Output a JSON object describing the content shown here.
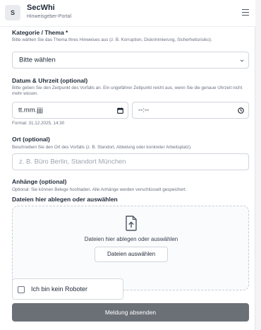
{
  "header": {
    "logo_letter": "S",
    "title": "SecWhi",
    "subtitle": "Hinweisgeber-Portal",
    "menu_icon": "hamburger-menu-icon"
  },
  "category": {
    "label": "Kategorie / Thema *",
    "hint": "Bitte wählen Sie das Thema Ihres Hinweises aus (z. B. Korruption, Diskriminierung, Sicherheitsrisiko).",
    "selected": "Bitte wählen"
  },
  "datetime": {
    "label": "Datum & Uhrzeit (optional)",
    "hint": "Bitte geben Sie den Zeitpunkt des Vorfalls an. Ein ungefährer Zeitpunkt reicht aus, wenn Sie die genaue Uhrzeit nicht mehr wissen.",
    "date_value": "tt.mm.jjjj",
    "time_value": "--:--",
    "format_hint": "Format: 31.12.2025, 14:30"
  },
  "location": {
    "label": "Ort (optional)",
    "hint": "Beschreiben Sie den Ort des Vorfalls (z. B. Standort, Abteilung oder konkreter Arbeitsplatz).",
    "placeholder": "z. B. Büro Berlin, Standort München"
  },
  "attachments": {
    "label": "Anhänge (optional)",
    "hint": "Optional: Sie können Belege hochladen. Alle Anhänge werden verschlüsselt gespeichert.",
    "sublabel": "Dateien hier ablegen oder auswählen",
    "drop_text": "Dateien hier ablegen oder auswählen",
    "button": "Dateien auswählen"
  },
  "captcha": {
    "label": "Ich bin kein Roboter",
    "checked": false
  },
  "submit": {
    "label": "Meldung absenden"
  },
  "colors": {
    "submit_bg": "#6b7077",
    "border": "#d1d5db"
  }
}
